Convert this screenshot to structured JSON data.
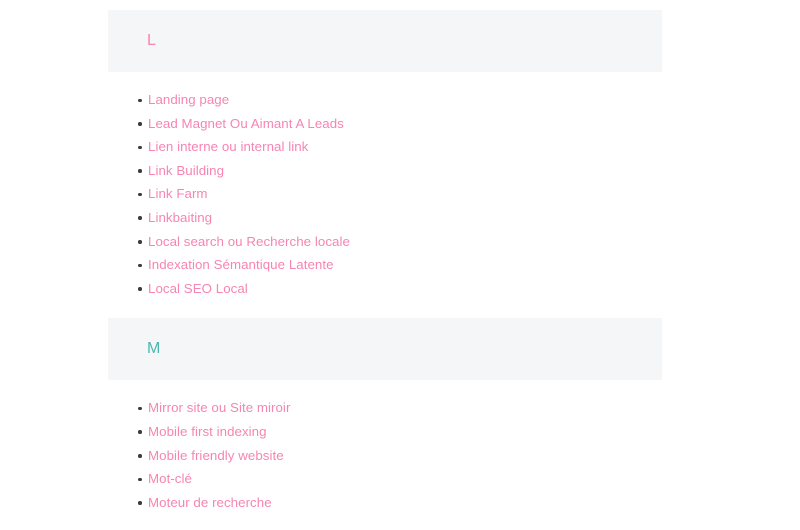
{
  "page": {
    "background_color": "#ffffff",
    "panel_color": "#f5f6f8",
    "link_color": "#f785b1",
    "bullet_color": "#3c3c3c"
  },
  "sections": [
    {
      "letter": "L",
      "letter_color": "#f785b1",
      "items": [
        {
          "label": "Landing page"
        },
        {
          "label": "Lead Magnet Ou Aimant A Leads"
        },
        {
          "label": "Lien interne ou internal link"
        },
        {
          "label": "Link Building"
        },
        {
          "label": "Link Farm"
        },
        {
          "label": "Linkbaiting"
        },
        {
          "label": "Local search ou Recherche locale"
        },
        {
          "label": "Indexation Sémantique Latente"
        },
        {
          "label": "Local SEO Local"
        }
      ]
    },
    {
      "letter": "M",
      "letter_color": "#4cb7ad",
      "items": [
        {
          "label": "Mirror site ou Site miroir"
        },
        {
          "label": "Mobile first indexing"
        },
        {
          "label": "Mobile friendly website"
        },
        {
          "label": "Mot-clé"
        },
        {
          "label": "Moteur de recherche"
        }
      ]
    }
  ]
}
